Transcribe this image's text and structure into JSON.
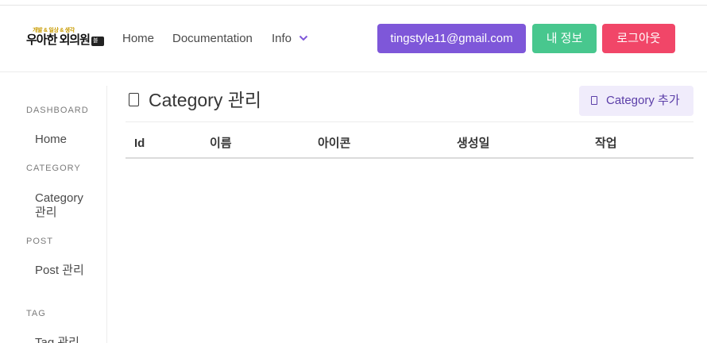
{
  "navbar": {
    "logo": {
      "tagline": "개발 & 일상 & 생각",
      "name": "우아한 외의원",
      "badge": "블로그"
    },
    "links": {
      "home": "Home",
      "docs": "Documentation",
      "info": "Info"
    },
    "buttons": {
      "email": "tingstyle11@gmail.com",
      "my_info": "내 정보",
      "logout": "로그아웃"
    },
    "colors": {
      "email": "#7e57d9",
      "my_info": "#48c78e",
      "logout": "#f14668"
    }
  },
  "sidebar": {
    "sections": [
      {
        "label": "DASHBOARD",
        "items": [
          "Home"
        ]
      },
      {
        "label": "CATEGORY",
        "items": [
          "Category 관리"
        ]
      },
      {
        "label": "POST",
        "items": [
          "Post 관리"
        ]
      },
      {
        "label": "TAG",
        "items": [
          "Tag 관리"
        ]
      }
    ]
  },
  "main": {
    "title": "Category 관리",
    "title_icon": "square-icon",
    "add_button": {
      "label": "Category 추가",
      "icon": "square-icon"
    },
    "table": {
      "columns": [
        "Id",
        "이름",
        "아이콘",
        "생성일",
        "작업"
      ],
      "rows": []
    }
  }
}
